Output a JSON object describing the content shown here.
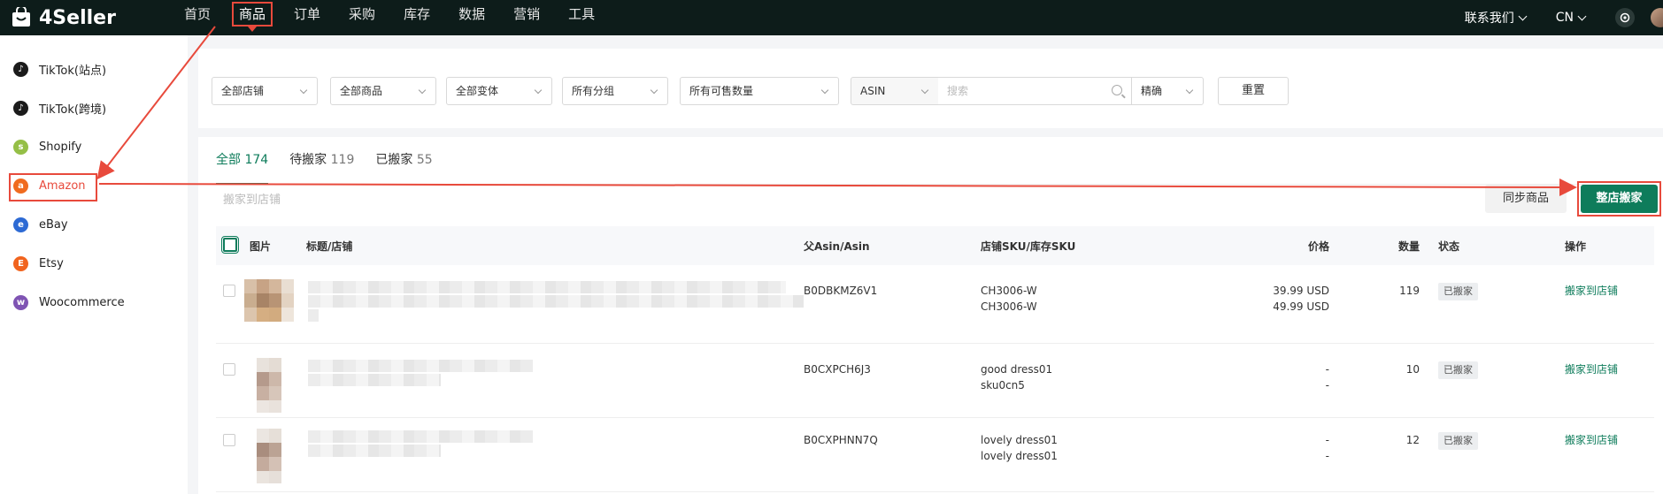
{
  "brand": {
    "name": "4Seller"
  },
  "nav": [
    "首页",
    "商品",
    "订单",
    "采购",
    "库存",
    "数据",
    "营销",
    "工具"
  ],
  "nav_active": "商品",
  "top_right": {
    "contact": "联系我们",
    "lang": "CN"
  },
  "sidebar": {
    "items": [
      {
        "label": "TikTok(站点)",
        "icon_color": "#1b1b1b"
      },
      {
        "label": "TikTok(跨境)",
        "icon_color": "#1b1b1b"
      },
      {
        "label": "Shopify",
        "icon_color": "#95bf47"
      },
      {
        "label": "Amazon",
        "icon_color": "#f06b1f"
      },
      {
        "label": "eBay",
        "icon_color": "#2d6ad4"
      },
      {
        "label": "Etsy",
        "icon_color": "#f1641e"
      },
      {
        "label": "Woocommerce",
        "icon_color": "#7f54b3"
      }
    ],
    "active": "Amazon"
  },
  "filters": {
    "store": "全部店铺",
    "product": "全部商品",
    "variant": "全部变体",
    "group": "所有分组",
    "qty": "所有可售数量",
    "field": "ASIN",
    "search_placeholder": "搜索",
    "match": "精确",
    "reset": "重置"
  },
  "tabs": [
    {
      "label": "全部",
      "count": "174"
    },
    {
      "label": "待搬家",
      "count": "119"
    },
    {
      "label": "已搬家",
      "count": "55"
    }
  ],
  "toolbar": {
    "move_to_store": "搬家到店铺",
    "sync": "同步商品",
    "whole_store_move": "整店搬家"
  },
  "table": {
    "headers": {
      "image": "图片",
      "title": "标题/店铺",
      "asin": "父Asin/Asin",
      "sku": "店铺SKU/库存SKU",
      "price": "价格",
      "qty": "数量",
      "status": "状态",
      "action": "操作"
    },
    "rows": [
      {
        "asin": "B0DBKMZ6V1",
        "sku1": "CH3006-W",
        "sku2": "CH3006-W",
        "price1": "39.99 USD",
        "price2": "49.99 USD",
        "qty": "119",
        "status": "已搬家",
        "action": "搬家到店铺"
      },
      {
        "asin": "B0CXPCH6J3",
        "sku1": "good dress01",
        "sku2": "sku0cn5",
        "price1": "-",
        "price2": "-",
        "qty": "10",
        "status": "已搬家",
        "action": "搬家到店铺"
      },
      {
        "asin": "B0CXPHNN7Q",
        "sku1": "lovely dress01",
        "sku2": "lovely dress01",
        "price1": "-",
        "price2": "-",
        "qty": "12",
        "status": "已搬家",
        "action": "搬家到店铺"
      }
    ]
  },
  "colors": {
    "accent": "#0e7c5b",
    "annotation": "#e84a3c",
    "topbar": "#0d1c1a"
  }
}
